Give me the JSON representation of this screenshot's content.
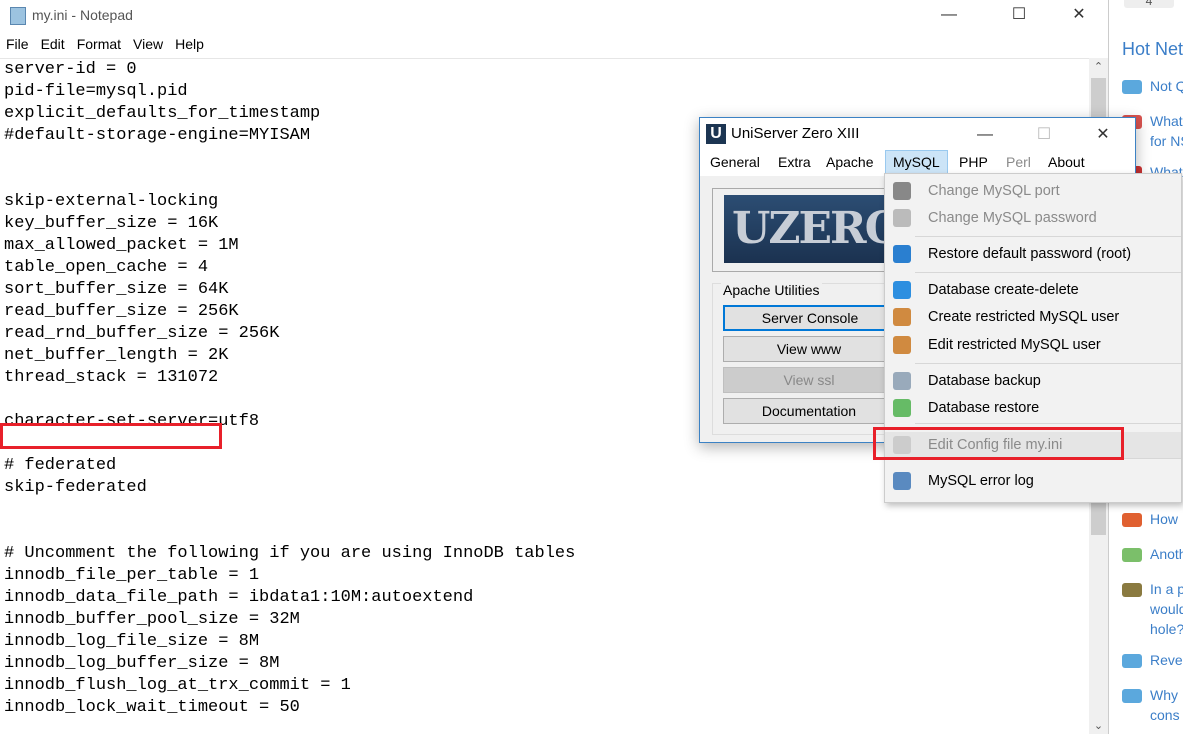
{
  "notepad": {
    "title": "my.ini - Notepad",
    "menu": [
      "File",
      "Edit",
      "Format",
      "View",
      "Help"
    ],
    "lines": [
      "server-id = 0",
      "pid-file=mysql.pid",
      "explicit_defaults_for_timestamp",
      "#default-storage-engine=MYISAM",
      "",
      "",
      "skip-external-locking",
      "key_buffer_size = 16K",
      "max_allowed_packet = 1M",
      "table_open_cache = 4",
      "sort_buffer_size = 64K",
      "read_buffer_size = 256K",
      "read_rnd_buffer_size = 256K",
      "net_buffer_length = 2K",
      "thread_stack = 131072",
      "",
      "character-set-server=utf8",
      "",
      "# federated",
      "skip-federated",
      "",
      "",
      "# Uncomment the following if you are using InnoDB tables",
      "innodb_file_per_table = 1",
      "innodb_data_file_path = ibdata1:10M:autoextend",
      "innodb_buffer_pool_size = 32M",
      "innodb_log_file_size = 8M",
      "innodb_log_buffer_size = 8M",
      "innodb_flush_log_at_trx_commit = 1",
      "innodb_lock_wait_timeout = 50"
    ],
    "highlight_color": "#e8202a"
  },
  "sidebar": {
    "badge": "4",
    "heading": "Hot Netw",
    "items": [
      {
        "icon": "PCG",
        "text": [
          "Not Q"
        ]
      },
      {
        "icon": "nsfw",
        "text": [
          "What",
          "for NS"
        ]
      },
      {
        "icon": "What",
        "text": [
          "What"
        ]
      },
      {
        "icon": "popcorn",
        "text": [
          "How"
        ]
      },
      {
        "icon": "diamond",
        "text": [
          "Anoth"
        ]
      },
      {
        "icon": "football",
        "text": [
          "In a p",
          "would",
          "hole?"
        ]
      },
      {
        "icon": "PCG",
        "text": [
          "Reve"
        ]
      },
      {
        "icon": "VI",
        "text": [
          "Why",
          "cons"
        ]
      }
    ]
  },
  "dialog": {
    "title": "UniServer Zero XIII",
    "logo": "UZERO",
    "menu": [
      "General",
      "Extra",
      "Apache",
      "MySQL",
      "PHP",
      "Perl",
      "About"
    ],
    "group": "Apache Utilities",
    "buttons": [
      "Server Console",
      "View www",
      "View ssl",
      "Documentation"
    ]
  },
  "mysql_menu": [
    {
      "label": "Change MySQL port",
      "disabled": true
    },
    {
      "label": "Change MySQL password",
      "disabled": true
    },
    {
      "label": "Restore default password (root)"
    },
    {
      "label": "Database create-delete"
    },
    {
      "label": "Create restricted MySQL user"
    },
    {
      "label": "Edit restricted MySQL user"
    },
    {
      "label": "Database backup"
    },
    {
      "label": "Database restore"
    },
    {
      "label": "Edit Config file my.ini",
      "disabled": true
    },
    {
      "label": "MySQL error log"
    }
  ]
}
